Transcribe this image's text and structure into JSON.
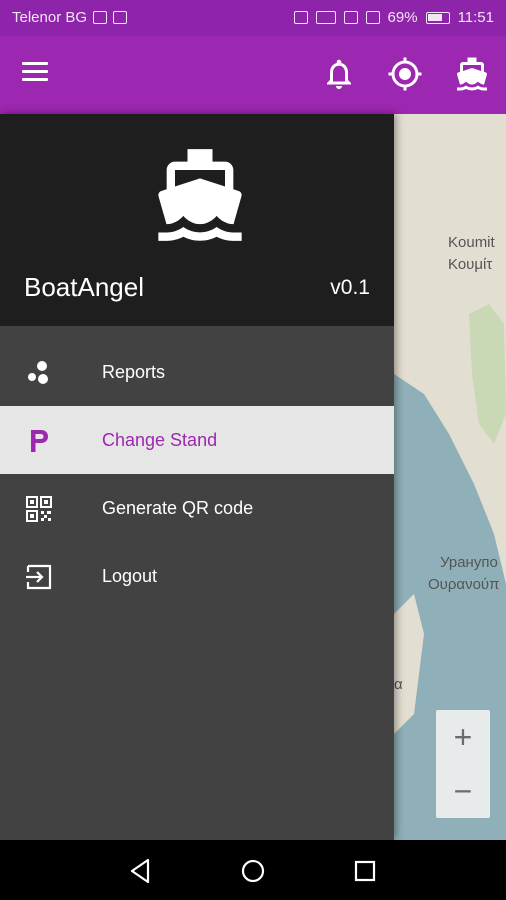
{
  "status_bar": {
    "carrier": "Telenor BG",
    "battery": "69%",
    "time": "11:51",
    "icons": [
      "sim-icon",
      "facebook-icon",
      "hotspot-icon",
      "volte-icon",
      "eye-icon",
      "signal-icon",
      "battery-icon"
    ]
  },
  "app_bar": {
    "icons": [
      "menu-icon",
      "bell-icon",
      "location-icon",
      "boat-icon"
    ],
    "color": "#9c27b0"
  },
  "drawer": {
    "app_name": "BoatAngel",
    "version": "v0.1",
    "logo_icon": "boat-icon",
    "items": [
      {
        "label": "Reports",
        "icon": "reports-icon",
        "active": false
      },
      {
        "label": "Change Stand",
        "icon": "parking-icon",
        "active": true
      },
      {
        "label": "Generate QR code",
        "icon": "qr-code-icon",
        "active": false
      },
      {
        "label": "Logout",
        "icon": "logout-icon",
        "active": false
      }
    ]
  },
  "map": {
    "labels": [
      "Koumit",
      "Κουμίτ",
      "Уранупо",
      "Ουρανούπ",
      "α"
    ],
    "zoom_in": "+",
    "zoom_out": "−"
  },
  "system_nav": {
    "icons": [
      "back-icon",
      "home-icon",
      "recents-icon"
    ]
  }
}
